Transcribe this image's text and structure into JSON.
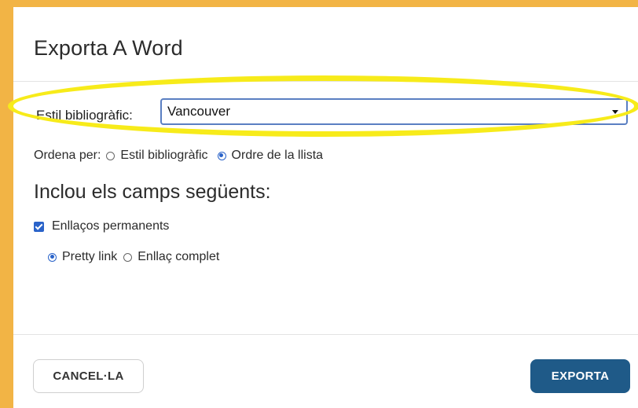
{
  "dialog": {
    "title": "Exporta A Word"
  },
  "bibliographic_style": {
    "label": "Estil bibliogràfic:",
    "selected": "Vancouver"
  },
  "sort": {
    "label": "Ordena per:",
    "options": [
      {
        "label": "Estil bibliogràfic",
        "selected": false
      },
      {
        "label": "Ordre de la llista",
        "selected": true
      }
    ]
  },
  "fields": {
    "heading": "Inclou els camps següents:",
    "permalinks": {
      "label": "Enllaços permanents",
      "checked": true
    },
    "link_type": [
      {
        "label": "Pretty link",
        "selected": true
      },
      {
        "label": "Enllaç complet",
        "selected": false
      }
    ]
  },
  "actions": {
    "cancel": "CANCEL·LA",
    "export": "EXPORTA"
  },
  "colors": {
    "background": "#F2B445",
    "highlight": "#F7EB1A",
    "primary_button": "#1F5A88",
    "accent": "#2A63C9"
  }
}
